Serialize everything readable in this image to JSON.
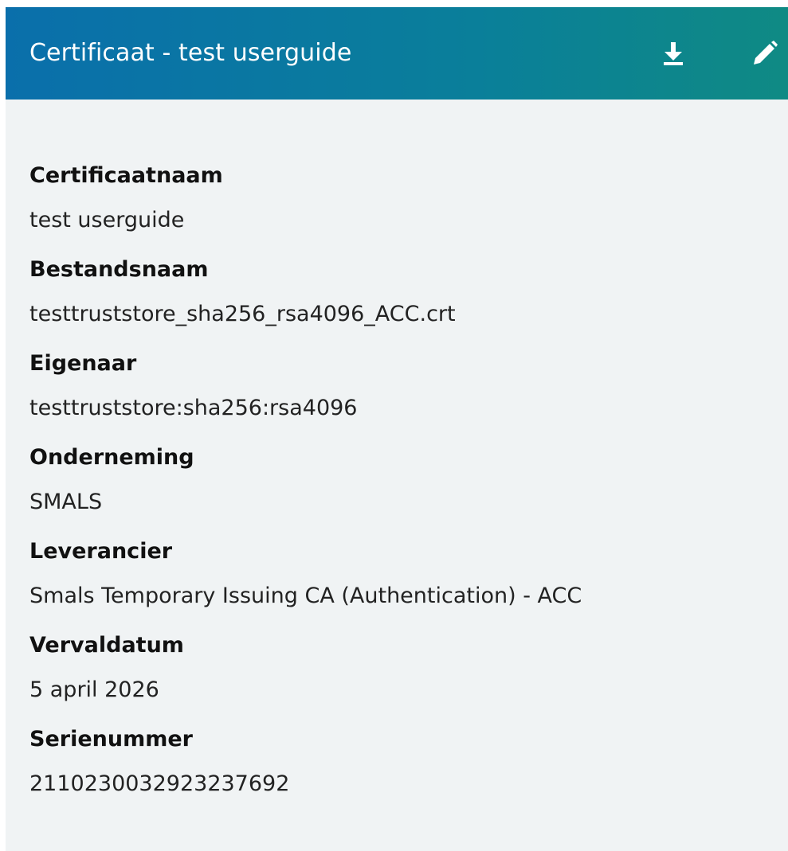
{
  "header": {
    "title": "Certificaat - test userguide",
    "download_icon": "download-icon",
    "edit_icon": "pencil-edit-icon",
    "gradient_start": "#0a6fab",
    "gradient_end": "#0f8a84"
  },
  "fields": [
    {
      "label": "Certificaatnaam",
      "value": "test userguide"
    },
    {
      "label": "Bestandsnaam",
      "value": "testtruststore_sha256_rsa4096_ACC.crt"
    },
    {
      "label": "Eigenaar",
      "value": "testtruststore:sha256:rsa4096"
    },
    {
      "label": "Onderneming",
      "value": "SMALS"
    },
    {
      "label": "Leverancier",
      "value": "Smals Temporary Issuing CA (Authentication) - ACC"
    },
    {
      "label": "Vervaldatum",
      "value": "5 april 2026"
    },
    {
      "label": "Serienummer",
      "value": "211023003292323769​2"
    }
  ]
}
